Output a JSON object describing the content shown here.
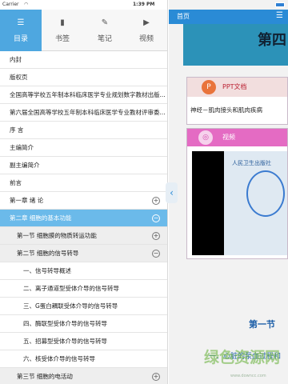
{
  "status_bar": {
    "carrier": "Carrier",
    "time": "1:39 PM"
  },
  "tabs": [
    {
      "label": "目录",
      "icon": "list-icon"
    },
    {
      "label": "书签",
      "icon": "bookmark-icon"
    },
    {
      "label": "笔记",
      "icon": "pencil-icon"
    },
    {
      "label": "视频",
      "icon": "video-icon"
    }
  ],
  "toc": [
    {
      "label": "内封"
    },
    {
      "label": "版权页"
    },
    {
      "label": "全国高等学校五年制本科临床医学专业规划数字教材出版..."
    },
    {
      "label": "第六届全国高等学校五年制本科临床医学专业教材评审委..."
    },
    {
      "label": "序 言"
    },
    {
      "label": "主编简介"
    },
    {
      "label": "副主编简介"
    },
    {
      "label": "前言"
    },
    {
      "label": "第一章 绪 论",
      "toggle": "+"
    },
    {
      "label": "第二章 细胞的基本功能",
      "toggle": "−"
    },
    {
      "label": "第一节 细胞膜的物质转运功能",
      "toggle": "+"
    },
    {
      "label": "第二节 细胞的信号转导",
      "toggle": "−"
    },
    {
      "label": "一、信号转导概述"
    },
    {
      "label": "二、离子通道型受体介导的信号转导"
    },
    {
      "label": "三、G蛋白耦联受体介导的信号转导"
    },
    {
      "label": "四、酶联型受体介导的信号转导"
    },
    {
      "label": "五、招募型受体介导的信号转导"
    },
    {
      "label": "六、核受体介导的信号转导"
    },
    {
      "label": "第三节 细胞的电活动",
      "toggle": "+"
    }
  ],
  "right": {
    "home": "首页",
    "banner_text": "第四",
    "ppt_card": {
      "type": "PPT文档",
      "badge": "P",
      "title": "神经－肌肉接头和肌肉疾病"
    },
    "video_card": {
      "type": "视频",
      "logo_text": "人民卫生出版社"
    },
    "tiny_text": "...",
    "chapter": "第一节",
    "subtitle": "一、心脏的泵血过程和",
    "watermark": "绿色资源网",
    "watermark_url": "www.downcc.com"
  }
}
